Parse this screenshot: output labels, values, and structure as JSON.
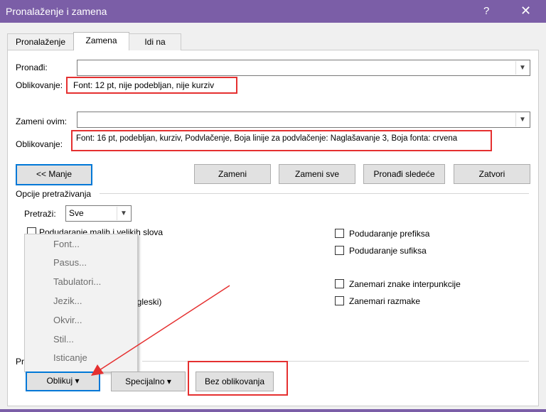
{
  "window": {
    "title": "Pronalaženje i zamena",
    "help_glyph": "?",
    "close_glyph": "✕"
  },
  "tabs": [
    {
      "label": "Pronalaženje"
    },
    {
      "label": "Zamena"
    },
    {
      "label": "Idi na"
    }
  ],
  "find": {
    "label": "Pronađi:",
    "value": "",
    "formatting_label": "Oblikovanje:",
    "formatting_value": "Font: 12 pt, nije podebljan, nije kurziv"
  },
  "replace": {
    "label": "Zameni ovim:",
    "value": "",
    "formatting_label": "Oblikovanje:",
    "formatting_value": "Font: 16 pt, podebljan, kurziv, Podvlačenje, Boja linije za podvlačenje: Naglašavanje 3, Boja fonta: crvena"
  },
  "buttons": {
    "less": "<< Manje",
    "replace": "Zameni",
    "replace_all": "Zameni sve",
    "find_next": "Pronađi sledeće",
    "close": "Zatvori",
    "format": "Oblikuj",
    "special": "Specijalno",
    "no_formatting": "Bez oblikovanja"
  },
  "search_options": {
    "group_label": "Opcije pretraživanja",
    "search_label": "Pretraži:",
    "search_value": "Sve",
    "match_case": "Podudaranje malih i velikih slova",
    "partial_text": "ngleski)",
    "match_prefix": "Podudaranje prefiksa",
    "match_suffix": "Podudaranje sufiksa",
    "ignore_punct": "Zanemari znake interpunkcije",
    "ignore_space": "Zanemari razmake"
  },
  "replace_group_label": "Pr",
  "format_menu": [
    "Font...",
    "Pasus...",
    "Tabulatori...",
    "Jezik...",
    "Okvir...",
    "Stil...",
    "Isticanje"
  ],
  "colors": {
    "titlebar": "#7b5ea7",
    "highlight": "#e53030",
    "focus": "#0078d7"
  }
}
